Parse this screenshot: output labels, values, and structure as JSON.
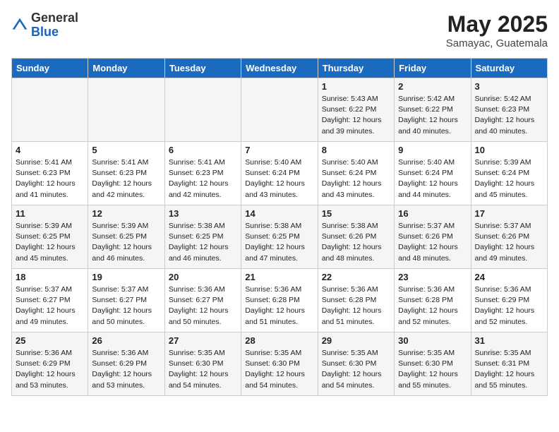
{
  "header": {
    "logo_general": "General",
    "logo_blue": "Blue",
    "month_title": "May 2025",
    "location": "Samayac, Guatemala"
  },
  "days_of_week": [
    "Sunday",
    "Monday",
    "Tuesday",
    "Wednesday",
    "Thursday",
    "Friday",
    "Saturday"
  ],
  "weeks": [
    [
      {
        "day": "",
        "sunrise": "",
        "sunset": "",
        "daylight": ""
      },
      {
        "day": "",
        "sunrise": "",
        "sunset": "",
        "daylight": ""
      },
      {
        "day": "",
        "sunrise": "",
        "sunset": "",
        "daylight": ""
      },
      {
        "day": "",
        "sunrise": "",
        "sunset": "",
        "daylight": ""
      },
      {
        "day": "1",
        "sunrise": "Sunrise: 5:43 AM",
        "sunset": "Sunset: 6:22 PM",
        "daylight": "Daylight: 12 hours and 39 minutes."
      },
      {
        "day": "2",
        "sunrise": "Sunrise: 5:42 AM",
        "sunset": "Sunset: 6:22 PM",
        "daylight": "Daylight: 12 hours and 40 minutes."
      },
      {
        "day": "3",
        "sunrise": "Sunrise: 5:42 AM",
        "sunset": "Sunset: 6:23 PM",
        "daylight": "Daylight: 12 hours and 40 minutes."
      }
    ],
    [
      {
        "day": "4",
        "sunrise": "Sunrise: 5:41 AM",
        "sunset": "Sunset: 6:23 PM",
        "daylight": "Daylight: 12 hours and 41 minutes."
      },
      {
        "day": "5",
        "sunrise": "Sunrise: 5:41 AM",
        "sunset": "Sunset: 6:23 PM",
        "daylight": "Daylight: 12 hours and 42 minutes."
      },
      {
        "day": "6",
        "sunrise": "Sunrise: 5:41 AM",
        "sunset": "Sunset: 6:23 PM",
        "daylight": "Daylight: 12 hours and 42 minutes."
      },
      {
        "day": "7",
        "sunrise": "Sunrise: 5:40 AM",
        "sunset": "Sunset: 6:24 PM",
        "daylight": "Daylight: 12 hours and 43 minutes."
      },
      {
        "day": "8",
        "sunrise": "Sunrise: 5:40 AM",
        "sunset": "Sunset: 6:24 PM",
        "daylight": "Daylight: 12 hours and 43 minutes."
      },
      {
        "day": "9",
        "sunrise": "Sunrise: 5:40 AM",
        "sunset": "Sunset: 6:24 PM",
        "daylight": "Daylight: 12 hours and 44 minutes."
      },
      {
        "day": "10",
        "sunrise": "Sunrise: 5:39 AM",
        "sunset": "Sunset: 6:24 PM",
        "daylight": "Daylight: 12 hours and 45 minutes."
      }
    ],
    [
      {
        "day": "11",
        "sunrise": "Sunrise: 5:39 AM",
        "sunset": "Sunset: 6:25 PM",
        "daylight": "Daylight: 12 hours and 45 minutes."
      },
      {
        "day": "12",
        "sunrise": "Sunrise: 5:39 AM",
        "sunset": "Sunset: 6:25 PM",
        "daylight": "Daylight: 12 hours and 46 minutes."
      },
      {
        "day": "13",
        "sunrise": "Sunrise: 5:38 AM",
        "sunset": "Sunset: 6:25 PM",
        "daylight": "Daylight: 12 hours and 46 minutes."
      },
      {
        "day": "14",
        "sunrise": "Sunrise: 5:38 AM",
        "sunset": "Sunset: 6:25 PM",
        "daylight": "Daylight: 12 hours and 47 minutes."
      },
      {
        "day": "15",
        "sunrise": "Sunrise: 5:38 AM",
        "sunset": "Sunset: 6:26 PM",
        "daylight": "Daylight: 12 hours and 48 minutes."
      },
      {
        "day": "16",
        "sunrise": "Sunrise: 5:37 AM",
        "sunset": "Sunset: 6:26 PM",
        "daylight": "Daylight: 12 hours and 48 minutes."
      },
      {
        "day": "17",
        "sunrise": "Sunrise: 5:37 AM",
        "sunset": "Sunset: 6:26 PM",
        "daylight": "Daylight: 12 hours and 49 minutes."
      }
    ],
    [
      {
        "day": "18",
        "sunrise": "Sunrise: 5:37 AM",
        "sunset": "Sunset: 6:27 PM",
        "daylight": "Daylight: 12 hours and 49 minutes."
      },
      {
        "day": "19",
        "sunrise": "Sunrise: 5:37 AM",
        "sunset": "Sunset: 6:27 PM",
        "daylight": "Daylight: 12 hours and 50 minutes."
      },
      {
        "day": "20",
        "sunrise": "Sunrise: 5:36 AM",
        "sunset": "Sunset: 6:27 PM",
        "daylight": "Daylight: 12 hours and 50 minutes."
      },
      {
        "day": "21",
        "sunrise": "Sunrise: 5:36 AM",
        "sunset": "Sunset: 6:28 PM",
        "daylight": "Daylight: 12 hours and 51 minutes."
      },
      {
        "day": "22",
        "sunrise": "Sunrise: 5:36 AM",
        "sunset": "Sunset: 6:28 PM",
        "daylight": "Daylight: 12 hours and 51 minutes."
      },
      {
        "day": "23",
        "sunrise": "Sunrise: 5:36 AM",
        "sunset": "Sunset: 6:28 PM",
        "daylight": "Daylight: 12 hours and 52 minutes."
      },
      {
        "day": "24",
        "sunrise": "Sunrise: 5:36 AM",
        "sunset": "Sunset: 6:29 PM",
        "daylight": "Daylight: 12 hours and 52 minutes."
      }
    ],
    [
      {
        "day": "25",
        "sunrise": "Sunrise: 5:36 AM",
        "sunset": "Sunset: 6:29 PM",
        "daylight": "Daylight: 12 hours and 53 minutes."
      },
      {
        "day": "26",
        "sunrise": "Sunrise: 5:36 AM",
        "sunset": "Sunset: 6:29 PM",
        "daylight": "Daylight: 12 hours and 53 minutes."
      },
      {
        "day": "27",
        "sunrise": "Sunrise: 5:35 AM",
        "sunset": "Sunset: 6:30 PM",
        "daylight": "Daylight: 12 hours and 54 minutes."
      },
      {
        "day": "28",
        "sunrise": "Sunrise: 5:35 AM",
        "sunset": "Sunset: 6:30 PM",
        "daylight": "Daylight: 12 hours and 54 minutes."
      },
      {
        "day": "29",
        "sunrise": "Sunrise: 5:35 AM",
        "sunset": "Sunset: 6:30 PM",
        "daylight": "Daylight: 12 hours and 54 minutes."
      },
      {
        "day": "30",
        "sunrise": "Sunrise: 5:35 AM",
        "sunset": "Sunset: 6:30 PM",
        "daylight": "Daylight: 12 hours and 55 minutes."
      },
      {
        "day": "31",
        "sunrise": "Sunrise: 5:35 AM",
        "sunset": "Sunset: 6:31 PM",
        "daylight": "Daylight: 12 hours and 55 minutes."
      }
    ]
  ]
}
